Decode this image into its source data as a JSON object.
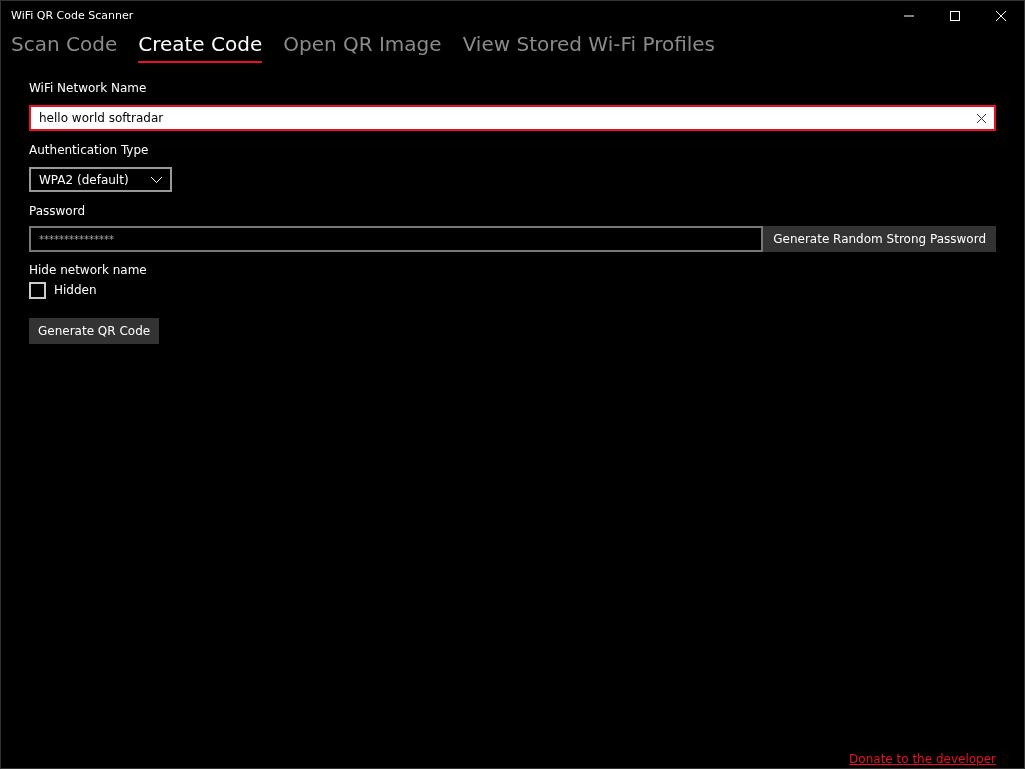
{
  "window": {
    "title": "WiFi QR Code Scanner"
  },
  "tabs": [
    {
      "label": "Scan Code",
      "selected": false
    },
    {
      "label": "Create Code",
      "selected": true
    },
    {
      "label": "Open QR Image",
      "selected": false
    },
    {
      "label": "View Stored Wi-Fi Profiles",
      "selected": false
    }
  ],
  "network_name": {
    "label": "WiFi Network Name",
    "value": "hello world softradar",
    "focused": true
  },
  "authentication": {
    "label": "Authentication Type",
    "value": "WPA2 (default)"
  },
  "password": {
    "label": "Password",
    "value": "***************",
    "button": "Generate Random Strong Password"
  },
  "hide_network": {
    "label": "Hide network name",
    "checkbox_label": "Hidden",
    "checked": false
  },
  "generate_button": "Generate QR Code",
  "donate_link": "Donate to the developer"
}
